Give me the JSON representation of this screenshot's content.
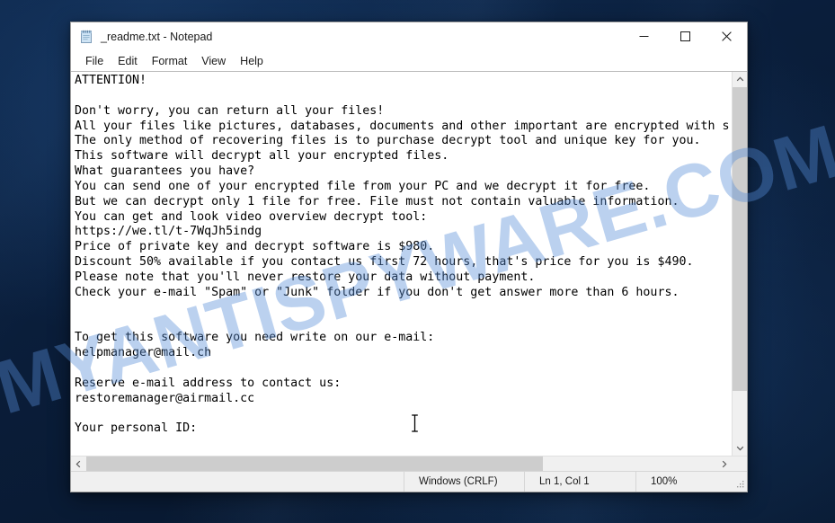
{
  "window": {
    "title": "_readme.txt - Notepad",
    "icon": "notepad-icon",
    "controls": {
      "minimize": "minimize-icon",
      "maximize": "maximize-icon",
      "close": "close-icon"
    }
  },
  "menubar": {
    "items": [
      {
        "label": "File"
      },
      {
        "label": "Edit"
      },
      {
        "label": "Format"
      },
      {
        "label": "View"
      },
      {
        "label": "Help"
      }
    ]
  },
  "document": {
    "filename": "_readme.txt",
    "lines": [
      "ATTENTION!",
      "",
      "Don't worry, you can return all your files!",
      "All your files like pictures, databases, documents and other important are encrypted with s",
      "The only method of recovering files is to purchase decrypt tool and unique key for you.",
      "This software will decrypt all your encrypted files.",
      "What guarantees you have?",
      "You can send one of your encrypted file from your PC and we decrypt it for free.",
      "But we can decrypt only 1 file for free. File must not contain valuable information.",
      "You can get and look video overview decrypt tool:",
      "https://we.tl/t-7WqJh5indg",
      "Price of private key and decrypt software is $980.",
      "Discount 50% available if you contact us first 72 hours, that's price for you is $490.",
      "Please note that you'll never restore your data without payment.",
      "Check your e-mail \"Spam\" or \"Junk\" folder if you don't get answer more than 6 hours.",
      "",
      "",
      "To get this software you need write on our e-mail:",
      "helpmanager@mail.ch",
      "",
      "Reserve e-mail address to contact us:",
      "restoremanager@airmail.cc",
      "",
      "Your personal ID:"
    ],
    "ransom": {
      "price_full": "$980",
      "price_discount": "$490",
      "discount_percent": "50%",
      "discount_window_hours": "72",
      "answer_wait_hours": "6",
      "free_decrypt_files": "1",
      "video_url": "https://we.tl/t-7WqJh5indg",
      "email_primary": "helpmanager@mail.ch",
      "email_reserve": "restoremanager@airmail.cc"
    }
  },
  "statusbar": {
    "encoding": "Windows (CRLF)",
    "position": "Ln 1, Col 1",
    "zoom": "100%"
  },
  "scrollbars": {
    "vertical_up": "chevron-up-icon",
    "vertical_down": "chevron-down-icon",
    "horizontal_left": "chevron-left-icon",
    "horizontal_right": "chevron-right-icon"
  },
  "watermark": {
    "text": "MYANTISPYWARE.COM",
    "color": "#568cd8"
  },
  "colors": {
    "desktop": "#0a1e3b",
    "window_bg": "#ffffff",
    "chrome_bg": "#f0f0f0",
    "text": "#000000",
    "close_hover": "#e81123"
  }
}
